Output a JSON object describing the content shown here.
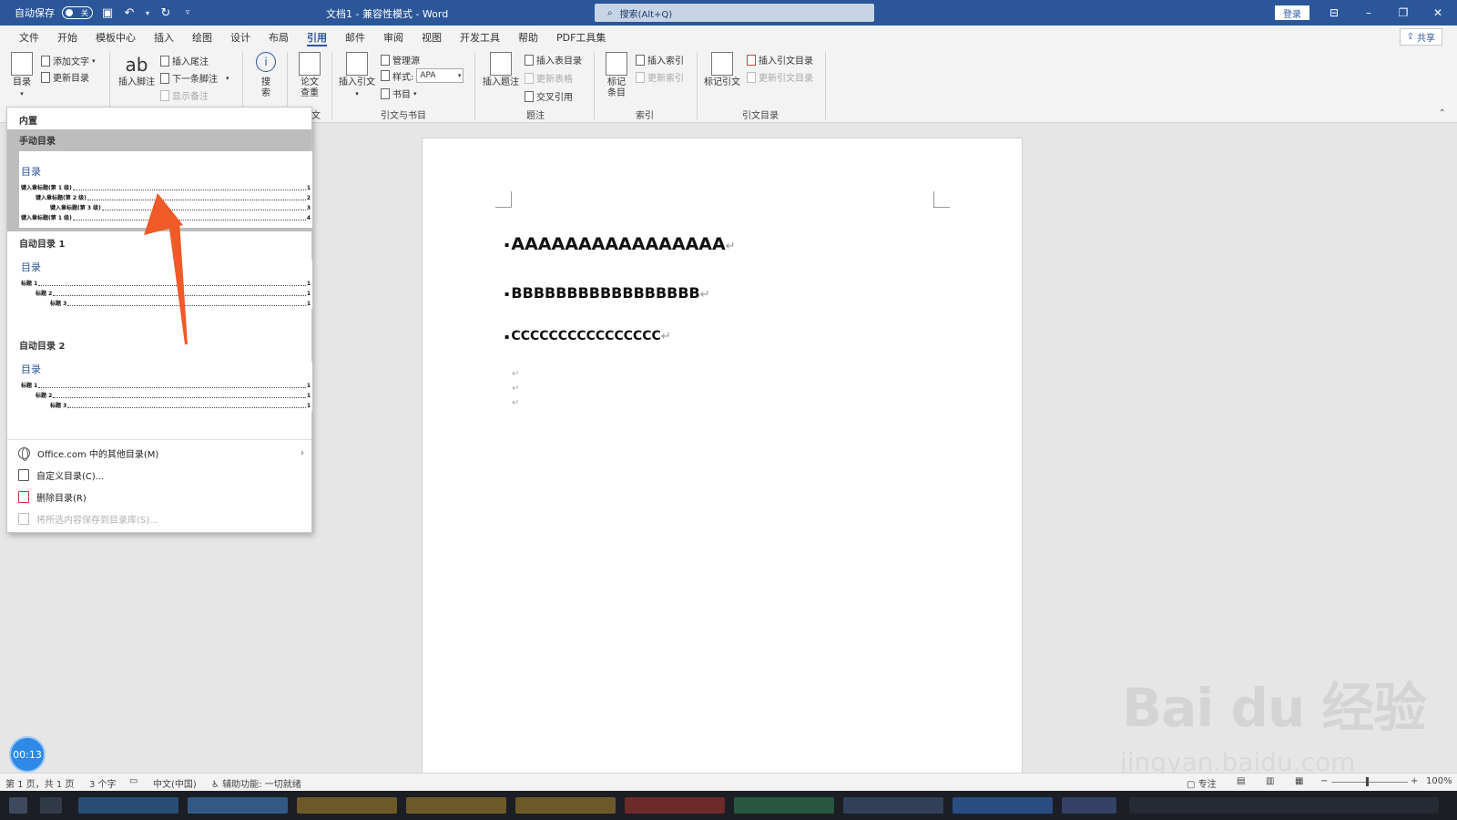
{
  "titlebar": {
    "autosave_label": "自动保存",
    "autosave_state": "关",
    "doc_title": "文档1 - 兼容性模式 - Word",
    "search_placeholder": "搜索(Alt+Q)",
    "login_label": "登录",
    "accent": "#2b579a"
  },
  "menu": {
    "tabs": [
      "文件",
      "开始",
      "模板中心",
      "插入",
      "绘图",
      "设计",
      "布局",
      "引用",
      "邮件",
      "审阅",
      "视图",
      "开发工具",
      "帮助",
      "PDF工具集"
    ],
    "active_tab": "引用",
    "share_label": "共享"
  },
  "ribbon": {
    "toc": {
      "label": "目录",
      "add_text": "添加文字",
      "update_toc": "更新目录"
    },
    "footnotes": {
      "insert_footnote": "插入脚注",
      "insert_endnote": "插入尾注",
      "next_footnote": "下一条脚注",
      "show_notes": "显示备注"
    },
    "research": {
      "search": "搜索",
      "paper_check": "论文查重",
      "partial_label": "文"
    },
    "citations": {
      "insert_citation": "插入引文",
      "manage_sources": "管理源",
      "style_label": "样式:",
      "style_value": "APA",
      "bibliography": "书目",
      "group_label": "引文与书目"
    },
    "captions": {
      "insert_caption": "插入题注",
      "insert_table_of_figures": "插入表目录",
      "update_table": "更新表格",
      "cross_reference": "交叉引用",
      "group_label": "题注"
    },
    "index": {
      "mark_entry": "标记条目",
      "insert_index": "插入索引",
      "update_index": "更新索引",
      "group_label": "索引"
    },
    "authorities": {
      "mark_citation": "标记引文",
      "insert_toa": "插入引文目录",
      "update_toa": "更新引文目录",
      "group_label": "引文目录"
    }
  },
  "toc_panel": {
    "builtin_label": "内置",
    "manual": {
      "header": "手动目录",
      "title": "目录",
      "lines": [
        {
          "text": "键入章标题(第 1 级)",
          "page": "1"
        },
        {
          "text": "键入章标题(第 2 级)",
          "page": "2"
        },
        {
          "text": "键入章标题(第 3 级)",
          "page": "3"
        },
        {
          "text": "键入章标题(第 1 级)",
          "page": "4"
        }
      ]
    },
    "auto1": {
      "header": "自动目录 1",
      "title": "目录",
      "lines": [
        {
          "text": "标题 1",
          "page": "1"
        },
        {
          "text": "标题 2",
          "page": "1"
        },
        {
          "text": "标题 3",
          "page": "1"
        }
      ]
    },
    "auto2": {
      "header": "自动目录 2",
      "title": "目录",
      "lines": [
        {
          "text": "标题 1",
          "page": "1"
        },
        {
          "text": "标题 2",
          "page": "1"
        },
        {
          "text": "标题 3",
          "page": "1"
        }
      ]
    },
    "more_online": "Office.com 中的其他目录(M)",
    "custom": "自定义目录(C)...",
    "remove": "删除目录(R)",
    "save_selection": "将所选内容保存到目录库(S)..."
  },
  "document": {
    "headings": [
      "AAAAAAAAAAAAAAAA",
      "BBBBBBBBBBBBBBBBB",
      "CCCCCCCCCCCCCCCC"
    ],
    "para_mark": "↵"
  },
  "timer": "00:13",
  "statusbar": {
    "page": "第 1 页，共 1 页",
    "words": "3 个字",
    "language": "中文(中国)",
    "accessibility": "辅助功能: 一切就绪",
    "focus": "专注",
    "zoom": "100%"
  },
  "watermark": {
    "brand": "Bai du 经验",
    "url": "jingyan.baidu.com"
  }
}
